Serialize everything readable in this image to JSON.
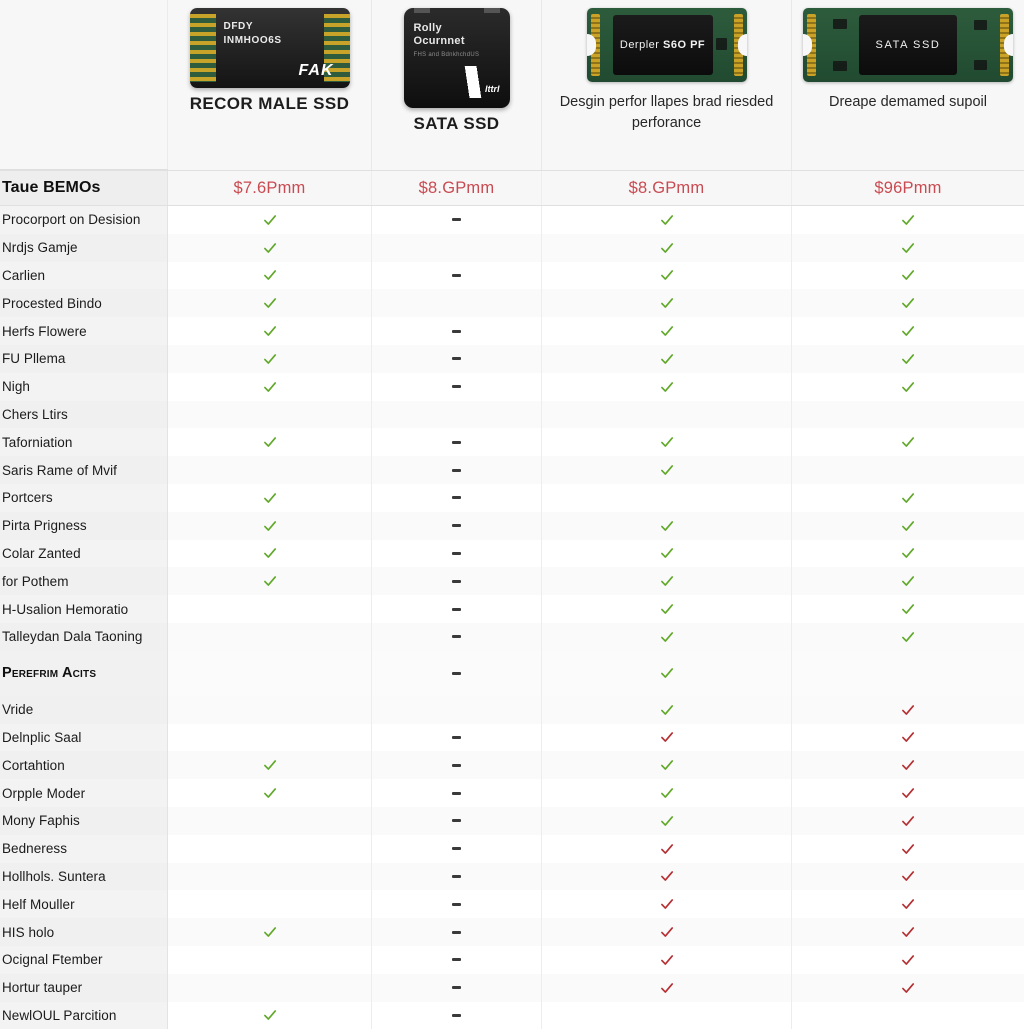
{
  "table": {
    "columns": [
      {
        "key": "c1",
        "title": "RECOR MALE SSD",
        "subtitle": "",
        "price": "$7.6Pmm",
        "image_name": "nvme-m2-ssd-black",
        "image_labels": {
          "line1": "DFDY",
          "line2": "INMHOO6S",
          "brand": "FAK"
        }
      },
      {
        "key": "c2",
        "title": "SATA SSD",
        "subtitle": "",
        "price": "$8.GPmm",
        "image_name": "sata-ssd-black-enclosure",
        "image_labels": {
          "line1": "Rolly",
          "line2": "Ocurnnet",
          "line3": "FHS and BdnkhchdUS",
          "brand": "lttrl"
        }
      },
      {
        "key": "c3",
        "title": "",
        "subtitle": "Desgin perfor llapes brad riesded perforance",
        "price": "$8.GPmm",
        "image_name": "m2-ssd-green-pcb",
        "image_labels": {
          "line1": "Derpler ",
          "line2": "S6O PF"
        }
      },
      {
        "key": "c4",
        "title": "",
        "subtitle": "Dreape demamed supoil",
        "price": "$96Pmm",
        "image_name": "m2-sata-ssd-green-pcb",
        "image_labels": {
          "line1": "SATA  SSD"
        }
      }
    ],
    "price_row_label": "Taue BEMOs",
    "rows": [
      {
        "label": "Procorport on Desision",
        "type": "data",
        "cells": [
          "yes",
          "dash",
          "yes",
          "yes"
        ]
      },
      {
        "label": "Nrdjs Gamje",
        "type": "data",
        "cells": [
          "yes",
          "blank",
          "yes",
          "yes"
        ]
      },
      {
        "label": "Carlien",
        "type": "data",
        "cells": [
          "yes",
          "dash",
          "yes",
          "yes"
        ]
      },
      {
        "label": "Procested Bindo",
        "type": "data",
        "cells": [
          "yes",
          "blank",
          "yes",
          "yes"
        ]
      },
      {
        "label": "Herfs Flowere",
        "type": "data",
        "cells": [
          "yes",
          "dash",
          "yes",
          "yes"
        ]
      },
      {
        "label": "FU Pllema",
        "type": "data",
        "cells": [
          "yes",
          "dash",
          "yes",
          "yes"
        ]
      },
      {
        "label": "Nigh",
        "type": "data",
        "cells": [
          "yes",
          "dash",
          "yes",
          "yes"
        ]
      },
      {
        "label": "Chers Ltirs",
        "type": "data",
        "cells": [
          "blank",
          "blank",
          "blank",
          "blank"
        ]
      },
      {
        "label": "Taforniation",
        "type": "data",
        "cells": [
          "yes",
          "dash",
          "yes",
          "yes"
        ]
      },
      {
        "label": "Saris Rame of Mvif",
        "type": "data",
        "cells": [
          "blank",
          "dash",
          "yes",
          "blank"
        ]
      },
      {
        "label": "Portcers",
        "type": "data",
        "cells": [
          "yes",
          "dash",
          "blank",
          "yes"
        ]
      },
      {
        "label": "Pirta Prigness",
        "type": "data",
        "cells": [
          "yes",
          "dash",
          "yes",
          "yes"
        ]
      },
      {
        "label": "Colar Zanted",
        "type": "data",
        "cells": [
          "yes",
          "dash",
          "yes",
          "yes"
        ]
      },
      {
        "label": "for Pothem",
        "type": "data",
        "cells": [
          "yes",
          "dash",
          "yes",
          "yes"
        ]
      },
      {
        "label": "H-Usalion Hemoratio",
        "type": "data",
        "cells": [
          "blank",
          "dash",
          "yes",
          "yes"
        ]
      },
      {
        "label": "Talleydan Dala Taoning",
        "type": "data",
        "cells": [
          "blank",
          "dash",
          "yes",
          "yes"
        ]
      },
      {
        "label": "Perefrim Acits",
        "type": "section",
        "cells": [
          "blank",
          "dash",
          "yes",
          "blank"
        ]
      },
      {
        "label": "Vride",
        "type": "data",
        "cells": [
          "blank",
          "blank",
          "yes",
          "no"
        ]
      },
      {
        "label": "Delnplic Saal",
        "type": "data",
        "cells": [
          "blank",
          "dash",
          "no",
          "no"
        ]
      },
      {
        "label": "Cortahtion",
        "type": "data",
        "cells": [
          "yes",
          "dash",
          "yes",
          "no"
        ]
      },
      {
        "label": "Orpple Moder",
        "type": "data",
        "cells": [
          "yes",
          "dash",
          "yes",
          "no"
        ]
      },
      {
        "label": "Mony Faphis",
        "type": "data",
        "cells": [
          "blank",
          "dash",
          "yes",
          "no"
        ]
      },
      {
        "label": "Bedneress",
        "type": "data",
        "cells": [
          "blank",
          "dash",
          "no",
          "no"
        ]
      },
      {
        "label": "Hollhols. Suntera",
        "type": "data",
        "cells": [
          "blank",
          "dash",
          "no",
          "no"
        ]
      },
      {
        "label": "Helf Mouller",
        "type": "data",
        "cells": [
          "blank",
          "dash",
          "no",
          "no"
        ]
      },
      {
        "label": "HIS holo",
        "type": "data",
        "cells": [
          "yes",
          "dash",
          "no",
          "no"
        ]
      },
      {
        "label": "Ocignal Ftember",
        "type": "data",
        "cells": [
          "blank",
          "dash",
          "no",
          "no"
        ]
      },
      {
        "label": "Hortur tauper",
        "type": "data",
        "cells": [
          "blank",
          "dash",
          "no",
          "no"
        ]
      },
      {
        "label": "NewlOUL Parcition",
        "type": "data",
        "cells": [
          "yes",
          "dash",
          "blank",
          "blank"
        ]
      }
    ]
  },
  "colors": {
    "check_yes": "#5fa828",
    "check_no": "#b52e31",
    "price": "#c94b52",
    "label_bg": "#f2f2f2",
    "header_bg": "#f7f7f7"
  },
  "icons": {
    "check": "check-icon",
    "cross_check": "red-check-icon",
    "dash": "dash-icon"
  }
}
